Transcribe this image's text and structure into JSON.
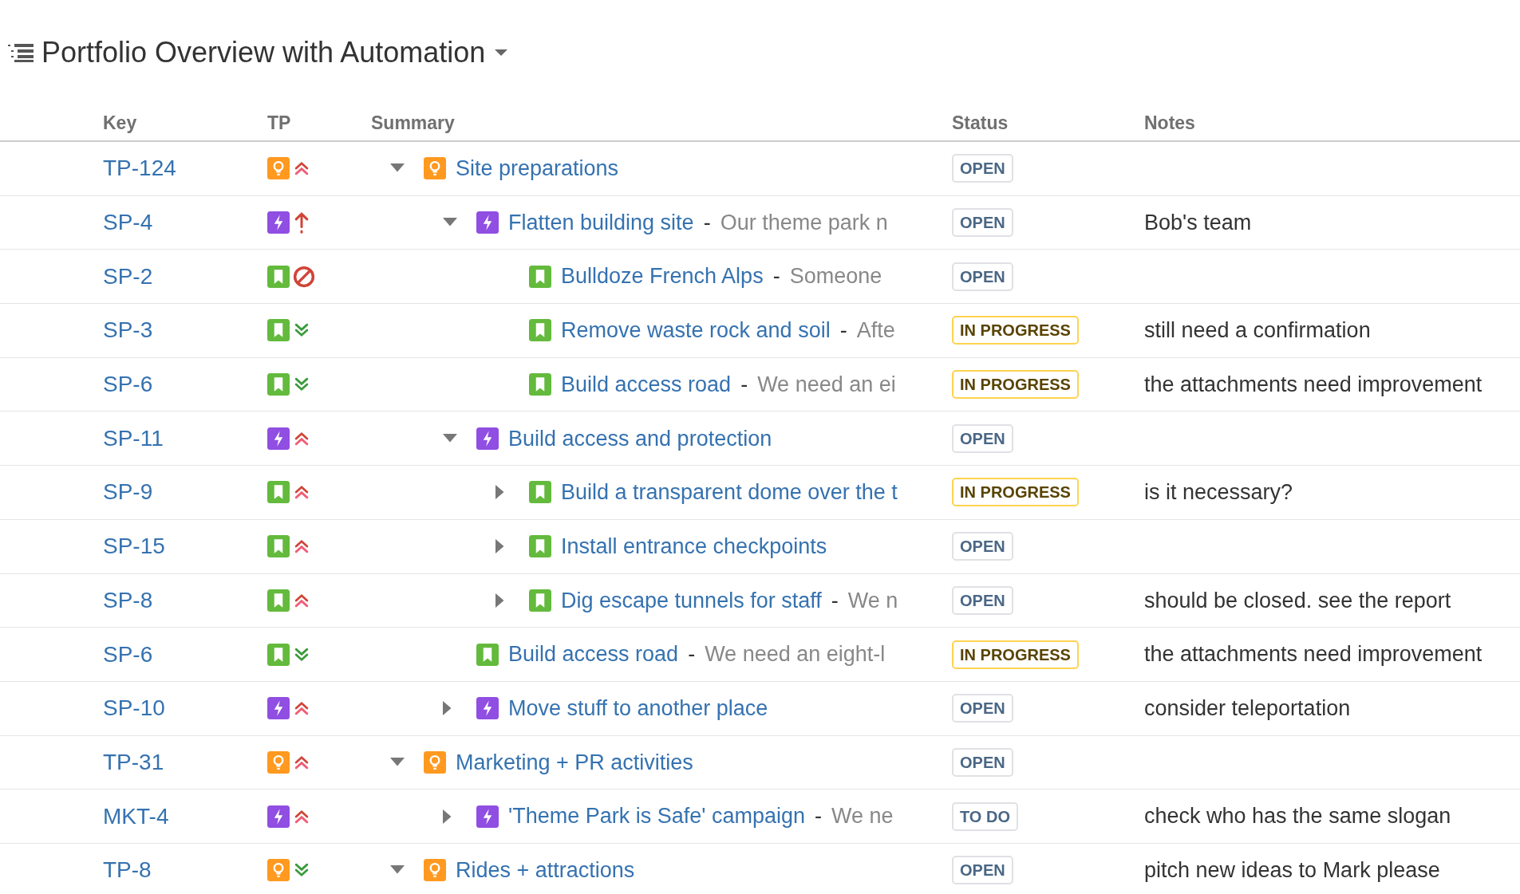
{
  "title": "Portfolio Overview with Automation",
  "columns": [
    "Key",
    "TP",
    "Summary",
    "Status",
    "Notes"
  ],
  "rows": [
    {
      "key": "TP-124",
      "kind": "idea",
      "priority": {
        "kind": "highest"
      },
      "title": "Site preparations",
      "expanded": true,
      "status": {
        "label": "OPEN",
        "kind": "default"
      },
      "children": [
        {
          "key": "SP-4",
          "kind": "epic",
          "priority": {
            "kind": "critical"
          },
          "title": "Flatten building site",
          "dash": "-",
          "description": "Our theme park n",
          "expanded": true,
          "status": {
            "label": "OPEN",
            "kind": "default"
          },
          "notes": "Bob's team",
          "children": [
            {
              "key": "SP-2",
              "kind": "story",
              "priority": {
                "kind": "blocker"
              },
              "title": "Bulldoze French Alps",
              "dash": "-",
              "description": "Someone",
              "status": {
                "label": "OPEN",
                "kind": "default"
              }
            },
            {
              "key": "SP-3",
              "kind": "story",
              "priority": {
                "kind": "lowest"
              },
              "title": "Remove waste rock and soil",
              "dash": "-",
              "description": "Afte",
              "status": {
                "label": "IN PROGRESS",
                "kind": "progress"
              },
              "notes": "still need a confirmation"
            },
            {
              "key": "SP-6",
              "kind": "story",
              "priority": {
                "kind": "lowest"
              },
              "title": "Build access road",
              "dash": "-",
              "description": "We need an ei",
              "status": {
                "label": "IN PROGRESS",
                "kind": "progress"
              },
              "notes": "the attachments need improvement"
            }
          ]
        },
        {
          "key": "SP-11",
          "kind": "epic",
          "priority": {
            "kind": "highest"
          },
          "title": "Build access and protection",
          "expanded": true,
          "status": {
            "label": "OPEN",
            "kind": "default"
          },
          "children": [
            {
              "key": "SP-9",
              "kind": "story",
              "priority": {
                "kind": "highest"
              },
              "title": "Build a transparent dome over the t",
              "expanded": false,
              "status": {
                "label": "IN PROGRESS",
                "kind": "progress"
              },
              "notes": "is it necessary?"
            },
            {
              "key": "SP-15",
              "kind": "story",
              "priority": {
                "kind": "highest"
              },
              "title": "Install entrance checkpoints",
              "expanded": false,
              "status": {
                "label": "OPEN",
                "kind": "default"
              }
            },
            {
              "key": "SP-8",
              "kind": "story",
              "priority": {
                "kind": "highest"
              },
              "title": "Dig escape tunnels for staff",
              "dash": "-",
              "description": "We n",
              "expanded": false,
              "status": {
                "label": "OPEN",
                "kind": "default"
              },
              "notes": "should be closed. see the report"
            }
          ]
        },
        {
          "key": "SP-6",
          "kind": "story",
          "priority": {
            "kind": "lowest"
          },
          "title": "Build access road",
          "dash": "-",
          "description": "We need an eight-l",
          "status": {
            "label": "IN PROGRESS",
            "kind": "progress"
          },
          "notes": "the attachments need improvement"
        },
        {
          "key": "SP-10",
          "kind": "epic",
          "priority": {
            "kind": "highest"
          },
          "title": "Move stuff to another place",
          "expanded": false,
          "status": {
            "label": "OPEN",
            "kind": "default"
          },
          "notes": "consider teleportation"
        }
      ]
    },
    {
      "key": "TP-31",
      "kind": "idea",
      "priority": {
        "kind": "highest"
      },
      "title": "Marketing + PR activities",
      "expanded": true,
      "status": {
        "label": "OPEN",
        "kind": "default"
      },
      "children": [
        {
          "key": "MKT-4",
          "kind": "epic",
          "priority": {
            "kind": "highest"
          },
          "title": "'Theme Park is Safe' campaign",
          "dash": "-",
          "description": "We ne",
          "expanded": false,
          "status": {
            "label": "TO DO",
            "kind": "default"
          },
          "notes": "check who has the same slogan"
        }
      ]
    },
    {
      "key": "TP-8",
      "kind": "idea",
      "priority": {
        "kind": "lowest"
      },
      "title": "Rides + attractions",
      "expanded": true,
      "status": {
        "label": "OPEN",
        "kind": "default"
      },
      "notes": "pitch new ideas to Mark please"
    }
  ]
}
